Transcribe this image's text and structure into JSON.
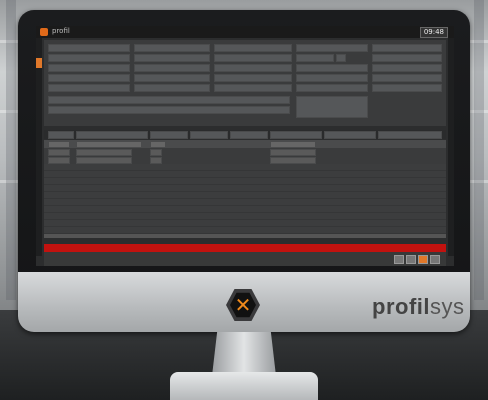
{
  "brand": {
    "name": "profilsys",
    "name_bold": "profil",
    "name_light": "sys",
    "logo_glyph": "✕",
    "accent": "#f08a1c"
  },
  "app": {
    "clock": "09:48",
    "title": "profil",
    "status_left": "",
    "status_right": ""
  },
  "colors": {
    "alert_bar": "#c2120f",
    "accent": "#e0782a"
  }
}
